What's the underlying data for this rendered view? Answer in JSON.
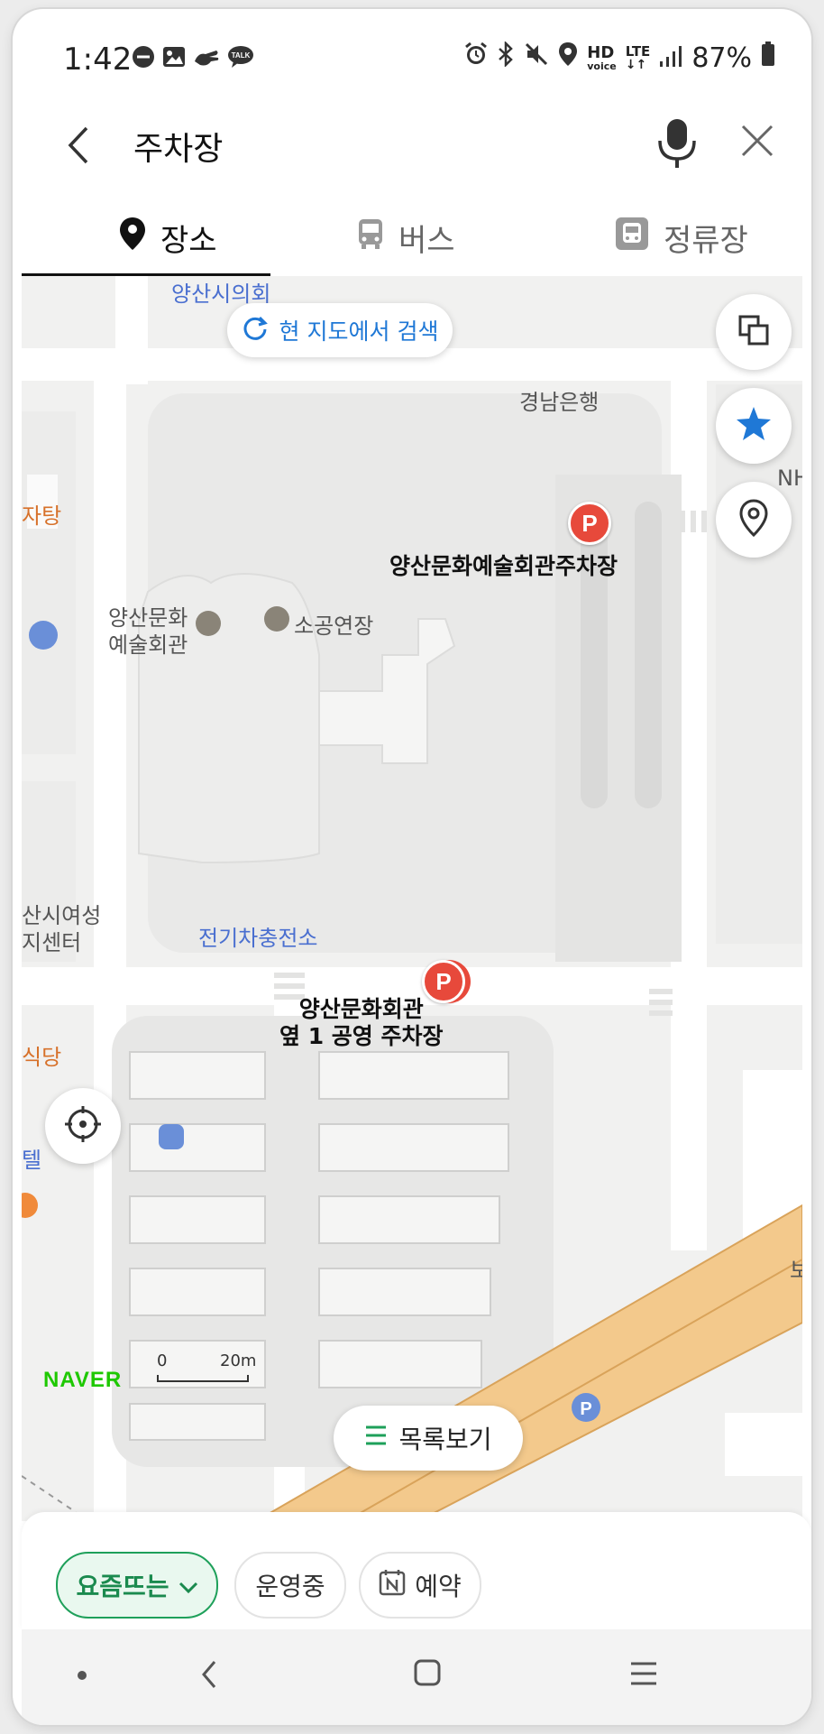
{
  "status_bar": {
    "time": "1:42",
    "battery": "87%",
    "left_icons": [
      "minus-circle-icon",
      "image-icon",
      "hand-icon",
      "talk-icon"
    ],
    "right_icons": [
      "alarm-icon",
      "bluetooth-icon",
      "mute-icon",
      "location-icon",
      "hd-voice-icon",
      "lte-icon",
      "signal-icon",
      "battery-icon"
    ],
    "talk_badge": "TALK",
    "hd_top": "HD",
    "hd_bottom": "voice",
    "lte_top": "LTE"
  },
  "search": {
    "query": "주차장"
  },
  "tabs": [
    {
      "label": "장소",
      "icon": "place-pin-icon",
      "active": true
    },
    {
      "label": "버스",
      "icon": "bus-icon",
      "active": false
    },
    {
      "label": "정류장",
      "icon": "bus-stop-icon",
      "active": false
    }
  ],
  "map": {
    "refresh_search_label": "현 지도에서 검색",
    "list_view_label": "목록보기",
    "naver_logo": "NAVER",
    "scale_left": "0",
    "scale_right": "20m",
    "labels": {
      "city_council": "양산시의회",
      "gyeongnam_bank": "경남은행",
      "nh": "NH",
      "jatang": "자탕",
      "arts_hall_1": "양산문화",
      "arts_hall_2": "예술회관",
      "small_theater": "소공연장",
      "parking_1": "양산문화예술회관주차장",
      "women_center_1": "산시여성",
      "women_center_2": "지센터",
      "ev_charging": "전기차충전소",
      "parking_2_line1": "양산문화회관",
      "parking_2_line2": "옆 1 공영 주차장",
      "restaurant": "식당",
      "tel": "텔",
      "bo": "보"
    },
    "parking_marker": "P"
  },
  "filters": [
    {
      "label": "요즘뜨는",
      "active": true
    },
    {
      "label": "운영중",
      "active": false
    },
    {
      "label": "예약",
      "active": false,
      "icon": "naver-booking-icon"
    }
  ],
  "colors": {
    "accent_blue": "#1f78d6",
    "green": "#1ea05a",
    "parking_red": "#e7493b",
    "road_orange": "#f3c98c"
  }
}
